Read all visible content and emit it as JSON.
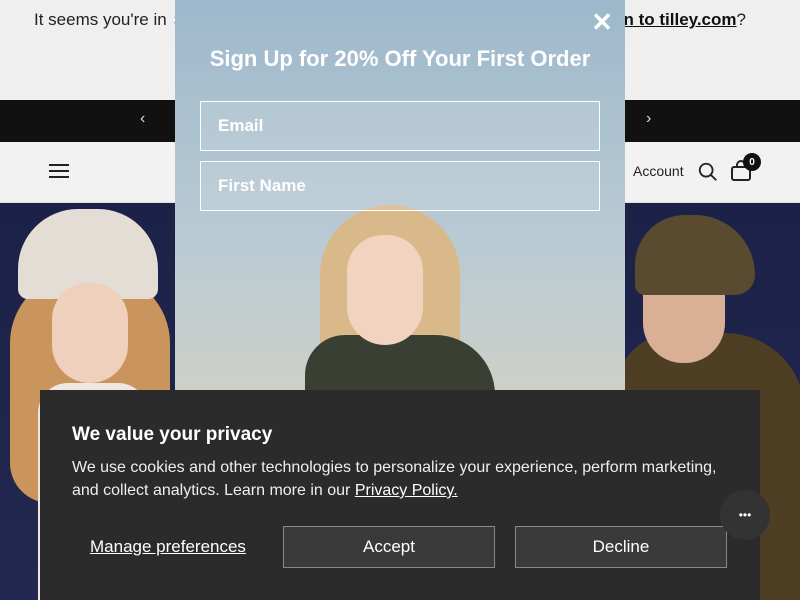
{
  "geo_banner": {
    "text_prefix": "It seems you're in",
    "link_text": "n to tilley.com",
    "suffix": "?"
  },
  "announcement": {
    "prev_arrow": "‹",
    "next_arrow": "›"
  },
  "header": {
    "account_label": "Account",
    "cart_count": "0"
  },
  "signup_modal": {
    "close_glyph": "✕",
    "title": "Sign Up for 20% Off Your First Order",
    "email_placeholder": "Email",
    "first_name_placeholder": "First Name"
  },
  "privacy_banner": {
    "title": "We value your privacy",
    "body": "We use cookies and other technologies to personalize your experience, perform marketing, and collect analytics. Learn more in our ",
    "policy_link": "Privacy Policy.",
    "manage_label": "Manage preferences",
    "accept_label": "Accept",
    "decline_label": "Decline"
  },
  "chat": {
    "glyph": "•••"
  },
  "icons": {
    "menu": "hamburger-icon",
    "search": "search-icon",
    "cart": "bag-icon",
    "close": "close-icon",
    "chat": "chat-icon",
    "flag": "netherlands-flag-icon"
  }
}
